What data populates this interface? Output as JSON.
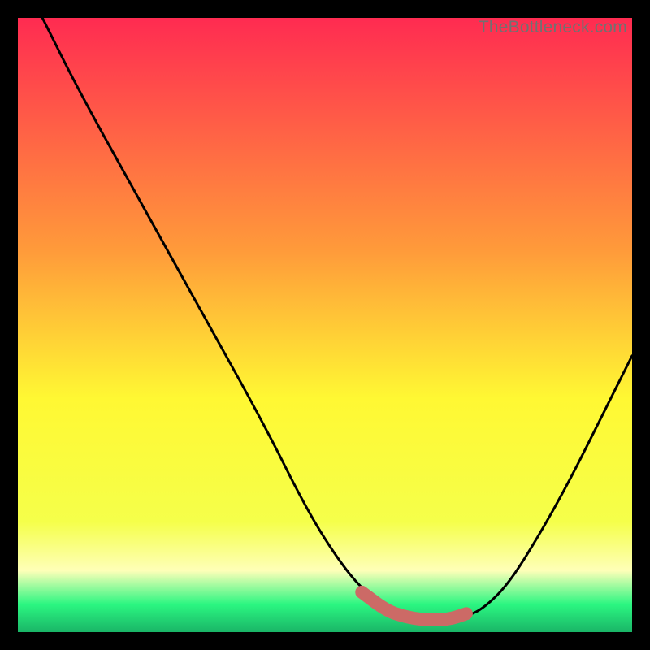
{
  "watermark": "TheBottleneck.com",
  "colors": {
    "curve": "#000000",
    "highlight": "#cc6a66",
    "gradient_top": "#ff2b51",
    "gradient_mid_upper": "#ffbb2e",
    "gradient_mid": "#fff833",
    "gradient_pale": "#feffb8",
    "gradient_green": "#2bf681",
    "gradient_deepgreen": "#1ab567"
  },
  "chart_data": {
    "type": "line",
    "title": "",
    "xlabel": "",
    "ylabel": "",
    "xlim": [
      0,
      100
    ],
    "ylim": [
      0,
      100
    ],
    "series": [
      {
        "name": "bottleneck-curve",
        "x": [
          0,
          4,
          10,
          20,
          30,
          40,
          47,
          52,
          56,
          60,
          63,
          66,
          70,
          73,
          76,
          80,
          85,
          90,
          95,
          100
        ],
        "values": [
          108,
          100,
          88,
          70,
          52,
          34,
          20,
          12,
          7,
          4,
          2.5,
          2,
          2,
          2.5,
          4,
          8,
          16,
          25,
          35,
          45
        ]
      },
      {
        "name": "optimal-range-highlight",
        "x": [
          56,
          60,
          63,
          66,
          70,
          73
        ],
        "values": [
          6.5,
          3.5,
          2.5,
          2,
          2,
          3
        ]
      }
    ],
    "annotations": []
  }
}
